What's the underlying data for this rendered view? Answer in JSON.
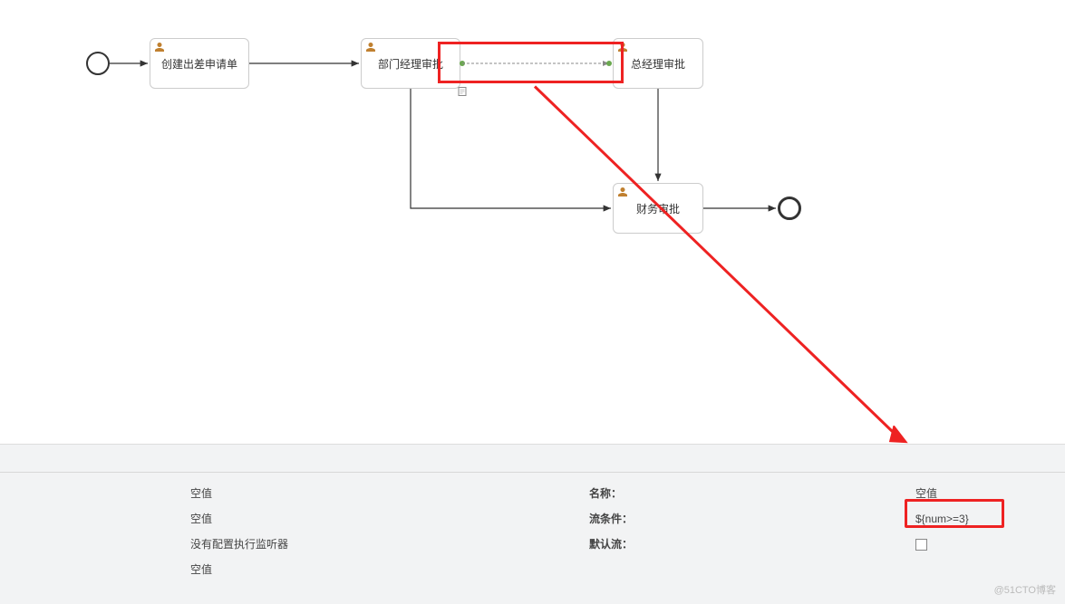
{
  "diagram": {
    "nodes": {
      "task1": "创建出差申请单",
      "task2": "部门经理审批",
      "task3": "总经理审批",
      "task4": "财务审批"
    }
  },
  "panel": {
    "left": {
      "r1": "空值",
      "r2": "空值",
      "r3": "没有配置执行监听器",
      "r4": "空值"
    },
    "right": {
      "name_label": "名称：",
      "name_value": "空值",
      "flow_label": "流条件：",
      "flow_value": "${num>=3}",
      "default_label": "默认流："
    }
  },
  "watermark": "@51CTO博客"
}
